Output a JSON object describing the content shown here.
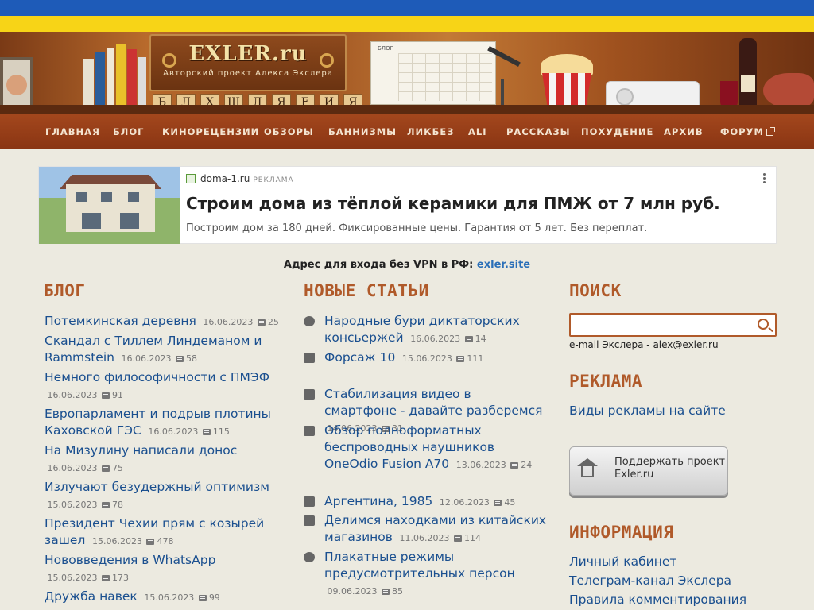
{
  "header": {
    "logo_title": "EXLER.ru",
    "logo_subtitle": "Авторский проект Алекса Экслера",
    "calendar_label": "БЛОГ",
    "letters": [
      "Б",
      "Л",
      "Х",
      "Ш",
      "Д",
      "Я",
      "Е",
      "И",
      "Я"
    ]
  },
  "nav": {
    "items": [
      "ГЛАВНАЯ",
      "БЛОГ",
      "КИНОРЕЦЕНЗИИ",
      "ОБЗОРЫ",
      "БАННИЗМЫ",
      "ЛИКБЕЗ",
      "ALI",
      "РАССКАЗЫ",
      "ПОХУДЕНИЕ",
      "АРХИВ",
      "ФОРУМ"
    ]
  },
  "ad": {
    "domain": "doma-1.ru",
    "label": "РЕКЛАМА",
    "title": "Строим дома из тёплой керамики для ПМЖ от 7 млн руб.",
    "text": "Построим дом за 180 дней. Фиксированные цены. Гарантия от 5 лет. Без переплат."
  },
  "vpn": {
    "text": "Адрес для входа без VPN в РФ: ",
    "link": "exler.site"
  },
  "blog": {
    "heading": "БЛОГ",
    "items": [
      {
        "title": "Потемкинская деревня",
        "date": "16.06.2023",
        "comments": "25"
      },
      {
        "title": "Скандал с Тиллем Линдеманом и Rammstein",
        "date": "16.06.2023",
        "comments": "58"
      },
      {
        "title": "Немного философичности с ПМЭФ",
        "date": "16.06.2023",
        "comments": "91"
      },
      {
        "title": "Европарламент и подрыв плотины Каховской ГЭС",
        "date": "16.06.2023",
        "comments": "115"
      },
      {
        "title": "На Мизулину написали донос",
        "date": "16.06.2023",
        "comments": "75"
      },
      {
        "title": "Излучают безудержный оптимизм",
        "date": "15.06.2023",
        "comments": "78"
      },
      {
        "title": "Президент Чехии прям с козырей зашел",
        "date": "15.06.2023",
        "comments": "478"
      },
      {
        "title": "Нововведения в WhatsApp",
        "date": "15.06.2023",
        "comments": "173"
      },
      {
        "title": "Дружба навек",
        "date": "15.06.2023",
        "comments": "99"
      }
    ]
  },
  "articles": {
    "heading": "НОВЫЕ СТАТЬИ",
    "items": [
      {
        "icon": "smiley-icon",
        "title": "Народные бури диктаторских консьержей",
        "date": "16.06.2023",
        "comments": "14"
      },
      {
        "icon": "clapperboard-icon",
        "title": "Форсаж 10",
        "date": "15.06.2023",
        "comments": "111"
      },
      {
        "icon": "question-icon",
        "title": "Стабилизация видео в смартфоне - давайте разберемся",
        "date": "14.06.2023",
        "comments": "31"
      },
      {
        "icon": "clipboard-check-icon",
        "title": "Обзор полноформатных беспроводных наушников OneOdio Fusion A70",
        "date": "13.06.2023",
        "comments": "24"
      },
      {
        "icon": "clapperboard-icon",
        "title": "Аргентина, 1985",
        "date": "12.06.2023",
        "comments": "45"
      },
      {
        "icon": "question-icon",
        "title": "Делимся находками из китайских магазинов",
        "date": "11.06.2023",
        "comments": "114"
      },
      {
        "icon": "smiley-icon",
        "title": "Плакатные режимы предусмотрительных персон",
        "date": "09.06.2023",
        "comments": "85"
      }
    ]
  },
  "sidebar": {
    "search_heading": "ПОИСК",
    "search_placeholder": "",
    "email_text": "e-mail Экслера - alex@exler.ru",
    "ads_heading": "РЕКЛАМА",
    "ads_link": "Виды рекламы на сайте",
    "support_line1": "Поддержать проект",
    "support_line2": "Exler.ru",
    "info_heading": "ИНФОРМАЦИЯ",
    "info_links": [
      "Личный кабинет",
      "Телеграм-канал Экслера",
      "Правила комментирования"
    ]
  },
  "colors": {
    "accent": "#b05a2a",
    "link": "#1a4f8f",
    "nav_bg": "#8a3513",
    "flag_blue": "#1e5bb8",
    "flag_yellow": "#f7d417"
  }
}
